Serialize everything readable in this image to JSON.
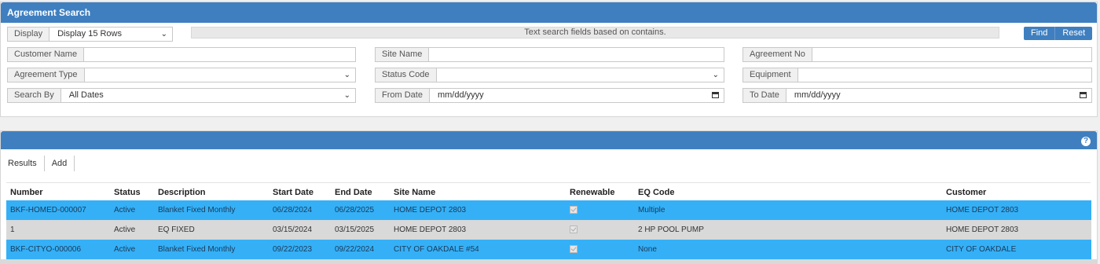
{
  "search": {
    "title": "Agreement Search",
    "display_label": "Display",
    "display_value": "Display 15 Rows",
    "info_text": "Text search fields based on contains.",
    "find_label": "Find",
    "reset_label": "Reset",
    "customer_name_label": "Customer Name",
    "site_name_label": "Site Name",
    "agreement_no_label": "Agreement No",
    "agreement_type_label": "Agreement Type",
    "status_code_label": "Status Code",
    "equipment_label": "Equipment",
    "search_by_label": "Search By",
    "search_by_value": "All Dates",
    "from_date_label": "From Date",
    "from_date_placeholder": "mm/dd/yyyy",
    "to_date_label": "To Date",
    "to_date_placeholder": "mm/dd/yyyy"
  },
  "results": {
    "tabs": [
      "Results",
      "Add"
    ],
    "columns": [
      "Number",
      "Status",
      "Description",
      "Start Date",
      "End Date",
      "Site Name",
      "Renewable",
      "EQ Code",
      "Customer"
    ],
    "rows": [
      {
        "number": "BKF-HOMED-000007",
        "status": "Active",
        "description": "Blanket Fixed Monthly",
        "start": "06/28/2024",
        "end": "06/28/2025",
        "site": "HOME DEPOT 2803",
        "renewable": true,
        "eq": "Multiple",
        "customer": "HOME DEPOT 2803"
      },
      {
        "number": "1",
        "status": "Active",
        "description": "EQ FIXED",
        "start": "03/15/2024",
        "end": "03/15/2025",
        "site": "HOME DEPOT 2803",
        "renewable": true,
        "eq": "2 HP POOL PUMP",
        "customer": "HOME DEPOT 2803"
      },
      {
        "number": "BKF-CITYO-000006",
        "status": "Active",
        "description": "Blanket Fixed Monthly",
        "start": "09/22/2023",
        "end": "09/22/2024",
        "site": "CITY OF OAKDALE #54",
        "renewable": true,
        "eq": "None",
        "customer": "CITY OF OAKDALE"
      }
    ]
  },
  "colors": {
    "header": "#3f7fc0",
    "row_highlight": "#35b0f6",
    "row_alt": "#d9d9d9"
  }
}
